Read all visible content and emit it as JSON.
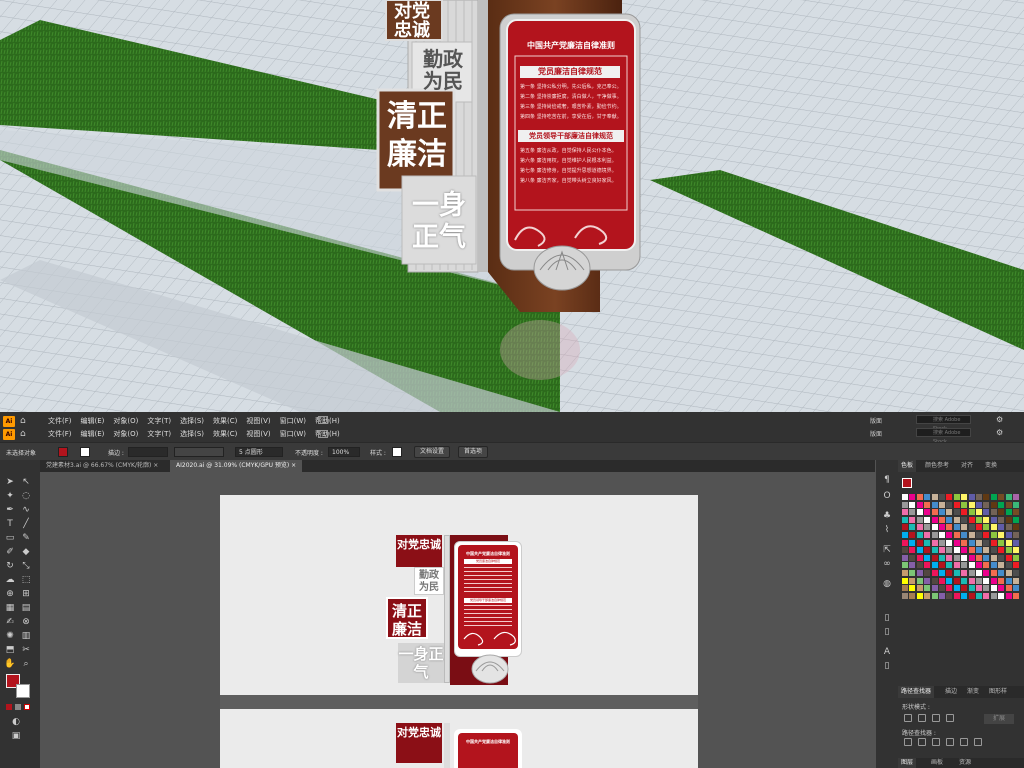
{
  "scene": {
    "column_left": {
      "panel1": "对党忠诚",
      "panel2": "勤政为民",
      "panel3": "清正廉洁",
      "panel4": "一身正气"
    },
    "board": {
      "title": "中国共产党廉洁自律准则",
      "section1": "党员廉洁自律规范",
      "section2": "党员领导干部廉洁自律规范",
      "body_line1": "第一条  坚持公私分明，先公后私，克己奉公。",
      "body_line2": "第二条  坚持崇廉拒腐，清白做人，干净做事。",
      "body_line3": "第三条  坚持尚俭戒奢，艰苦朴素，勤俭节约。",
      "body_line4": "第四条  坚持吃苦在前，享受在后，甘于奉献。",
      "body_line5": "第五条  廉洁从政，自觉保持人民公仆本色。",
      "body_line6": "第六条  廉洁用权，自觉维护人民根本利益。",
      "body_line7": "第七条  廉洁修身，自觉提升思想道德境界。",
      "body_line8": "第八条  廉洁齐家，自觉带头树立良好家风。"
    }
  },
  "illustrator": {
    "menus": [
      "文件(F)",
      "编辑(E)",
      "对象(O)",
      "文字(T)",
      "选择(S)",
      "效果(C)",
      "视图(V)",
      "窗口(W)",
      "帮助(H)"
    ],
    "workspace_label": "版面",
    "search_placeholder": "搜索 Adobe Stock",
    "control": {
      "selection_label": "未选择对象",
      "stroke_label": "描边 :",
      "stroke_value": "",
      "brush_value": "5 点圆形",
      "opacity_label": "不透明度 :",
      "opacity_value": "100%",
      "style_label": "样式 :",
      "doc_setup": "文档设置",
      "preferences": "首选项"
    },
    "tabs": [
      {
        "label": "党建素材3.ai @ 66.67% (CMYK/轮廓)",
        "close": "×"
      },
      {
        "label": "AI2020.ai @ 31.09% (CMYK/GPU 预览)",
        "close": "×"
      }
    ],
    "panel": {
      "tabs": [
        "色板",
        "颜色参考",
        "对齐",
        "变换"
      ],
      "pathfinder_tabs": [
        "路径查找器",
        "描边",
        "渐变",
        "图形样"
      ],
      "shape_modes": "形状模式 :",
      "pathfinder_label": "路径查找器 :",
      "expand": "扩展",
      "bottom_tabs": [
        "图层",
        "画板",
        "资源"
      ]
    },
    "artboard": {
      "p1": "对党忠诚",
      "p2": "勤政为民",
      "p3": "清正廉洁",
      "p4": "一身正气",
      "board_title": "中国共产党廉洁自律准则",
      "board_s1": "党员廉洁自律规范",
      "board_s2": "党员领导干部廉洁自律规范"
    },
    "colors": {
      "accent_red": "#b3141d",
      "deep_red": "#8b0f16",
      "brown": "#6b3a20",
      "grass": "#2f6b1f"
    }
  }
}
